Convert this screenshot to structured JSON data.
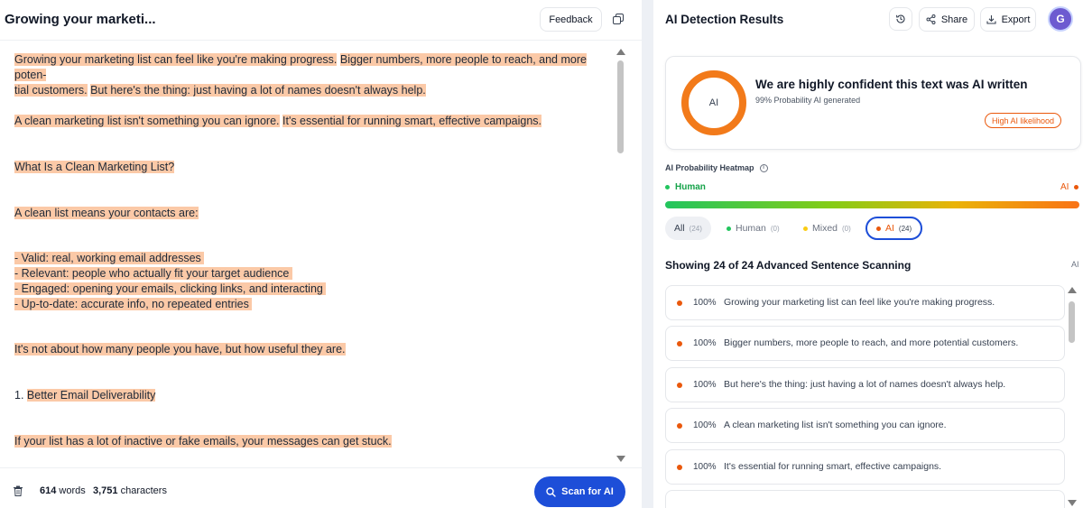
{
  "editor": {
    "doc_title": "Growing your marketi...",
    "feedback_label": "Feedback",
    "copy_icon": "copy-icon",
    "paragraphs": [
      {
        "segments": [
          "Growing your marketing list can feel like you're making progress.",
          "Bigger numbers, more people to reach, and more poten-",
          "tial customers.",
          "But here's the thing: just having a lot of names doesn't always help."
        ]
      },
      {
        "segments": [
          "A clean marketing list isn't something you can ignore.",
          "It's essential for running smart, effective campaigns."
        ]
      },
      {
        "segments": [
          "What Is a Clean Marketing List?"
        ]
      },
      {
        "segments": [
          "A clean list means your contacts are:"
        ]
      },
      {
        "segments": [
          "- Valid: real, working email addresses ",
          "- Relevant: people who actually fit your target audience ",
          "- Engaged: opening your emails, clicking links, and interacting ",
          "- Up-to-date: accurate info, no repeated entries "
        ]
      },
      {
        "segments": [
          "It's not about how many people you have, but how useful they are."
        ]
      },
      {
        "segments": [
          "1. ",
          "Better Email Deliverability"
        ]
      },
      {
        "segments": [
          "If your list has a lot of inactive or fake emails, your messages can get stuck."
        ]
      }
    ]
  },
  "footer": {
    "words_count": "614",
    "words_label": "words",
    "chars_count": "3,751",
    "chars_label": "characters",
    "scan_label": "Scan for AI"
  },
  "results": {
    "title": "AI Detection Results",
    "share_label": "Share",
    "export_label": "Export",
    "avatar_initial": "G",
    "gauge_label": "AI",
    "verdict": "We are highly confident this text was AI written",
    "probability": "99% Probability AI generated",
    "likelihood_badge": "High AI likelihood",
    "heatmap_label": "AI Probability Heatmap",
    "heatmap_human": "Human",
    "heatmap_ai": "AI",
    "filters": [
      {
        "label": "All",
        "count": "(24)"
      },
      {
        "label": "Human",
        "count": "(0)"
      },
      {
        "label": "Mixed",
        "count": "(0)"
      },
      {
        "label": "AI",
        "count": "(24)"
      }
    ],
    "showing": "Showing 24 of 24 Advanced Sentence Scanning",
    "showing_ai": "AI",
    "sentences": [
      {
        "pct": "100%",
        "text": "Growing your marketing list can feel like you're making progress."
      },
      {
        "pct": "100%",
        "text": "Bigger numbers, more people to reach, and more potential customers."
      },
      {
        "pct": "100%",
        "text": "But here's the thing: just having a lot of names doesn't always help."
      },
      {
        "pct": "100%",
        "text": "A clean marketing list isn't something you can ignore."
      },
      {
        "pct": "100%",
        "text": "It's essential for running smart, effective campaigns."
      }
    ]
  },
  "colors": {
    "highlight": "#fbc9a7",
    "ai_orange": "#ea580c",
    "human_green": "#22c55e",
    "mixed_yellow": "#facc15",
    "primary_blue": "#1d4ed8"
  }
}
